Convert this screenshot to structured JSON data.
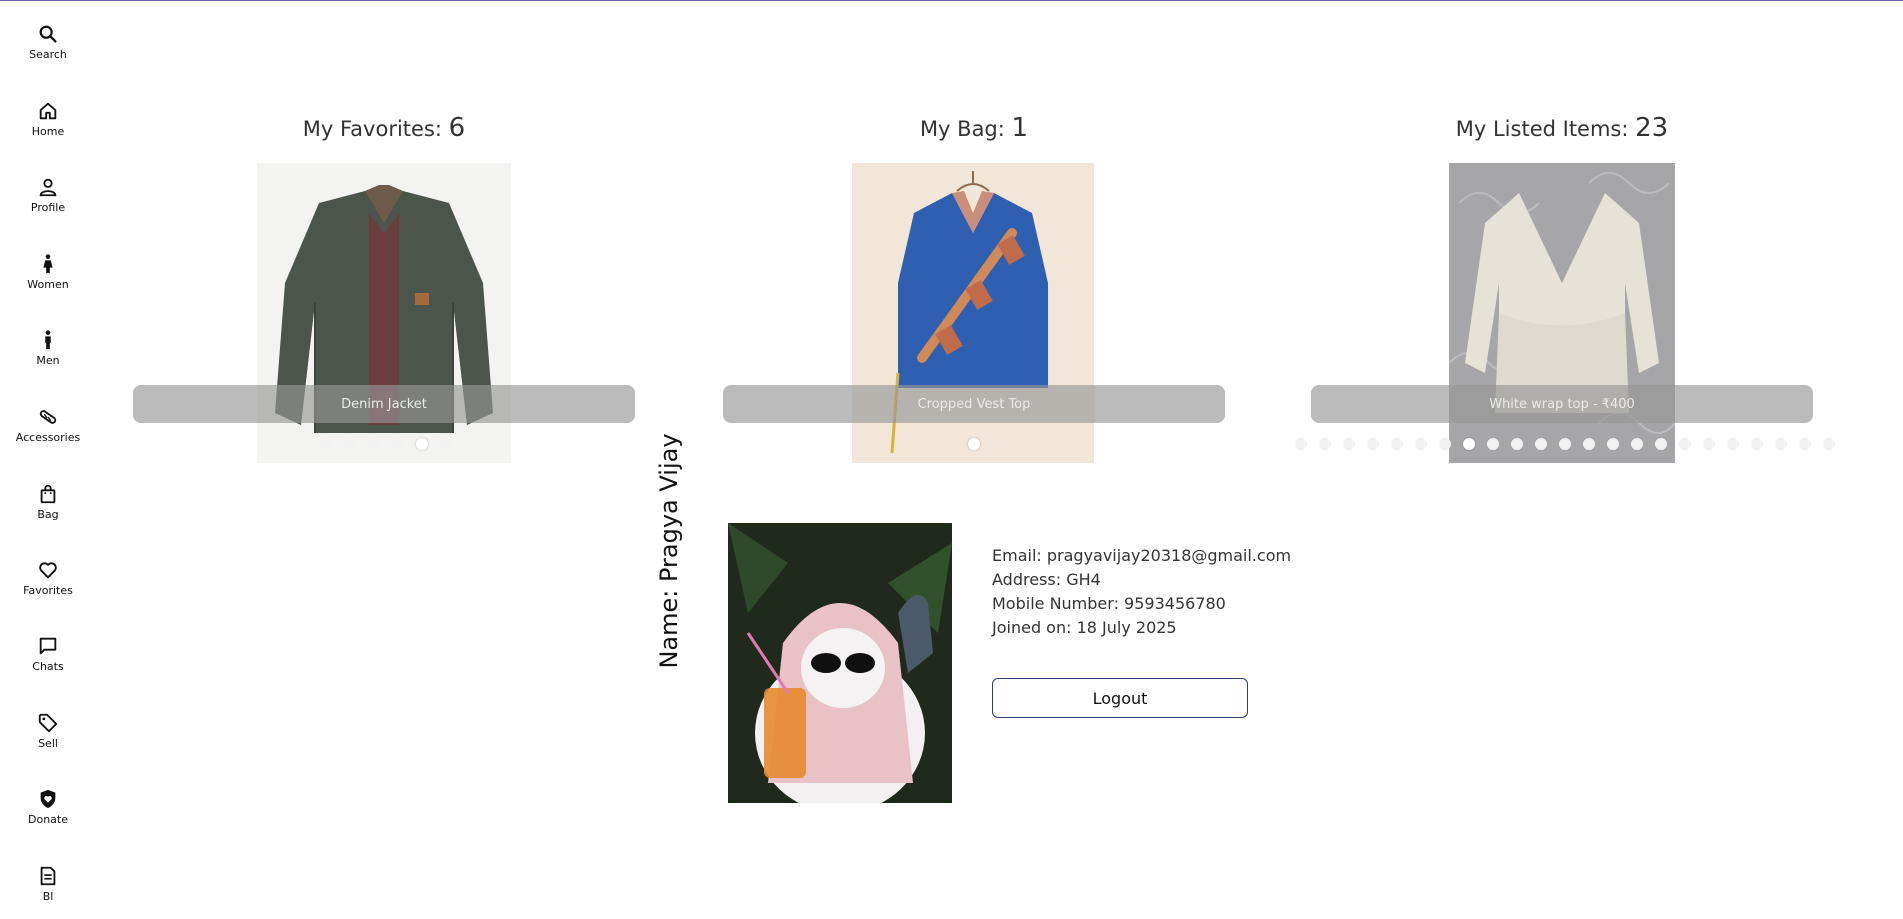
{
  "sidebar": {
    "items": [
      {
        "label": "Search",
        "icon": "search-icon"
      },
      {
        "label": "Home",
        "icon": "home-icon"
      },
      {
        "label": "Profile",
        "icon": "profile-icon"
      },
      {
        "label": "Women",
        "icon": "woman-icon"
      },
      {
        "label": "Men",
        "icon": "man-icon"
      },
      {
        "label": "Accessories",
        "icon": "bracelet-icon"
      },
      {
        "label": "Bag",
        "icon": "shopping-bag-icon"
      },
      {
        "label": "Favorites",
        "icon": "heart-icon"
      },
      {
        "label": "Chats",
        "icon": "chat-icon"
      },
      {
        "label": "Sell",
        "icon": "tag-icon"
      },
      {
        "label": "Donate",
        "icon": "heart-shield-icon"
      },
      {
        "label": "Bl",
        "icon": "document-icon"
      }
    ]
  },
  "favorites": {
    "title": "My Favorites: ",
    "count": "6",
    "caption": "Denim Jacket",
    "dot_count": 6,
    "active_dot": 4
  },
  "bag": {
    "title": "My Bag: ",
    "count": "1",
    "caption": "Cropped Vest Top",
    "dot_count": 1,
    "active_dot": 0
  },
  "listed": {
    "title": "My Listed Items: ",
    "count": "23",
    "caption": "White wrap top - ₹400",
    "dot_count": 23,
    "active_dot": 7
  },
  "profile": {
    "name": "Name: Pragya Vijay",
    "email": "Email: pragyavijay20318@gmail.com",
    "address": "Address: GH4",
    "mobile": "Mobile Number: 9593456780",
    "joined": "Joined on: 18 July 2025",
    "logout_label": "Logout"
  }
}
